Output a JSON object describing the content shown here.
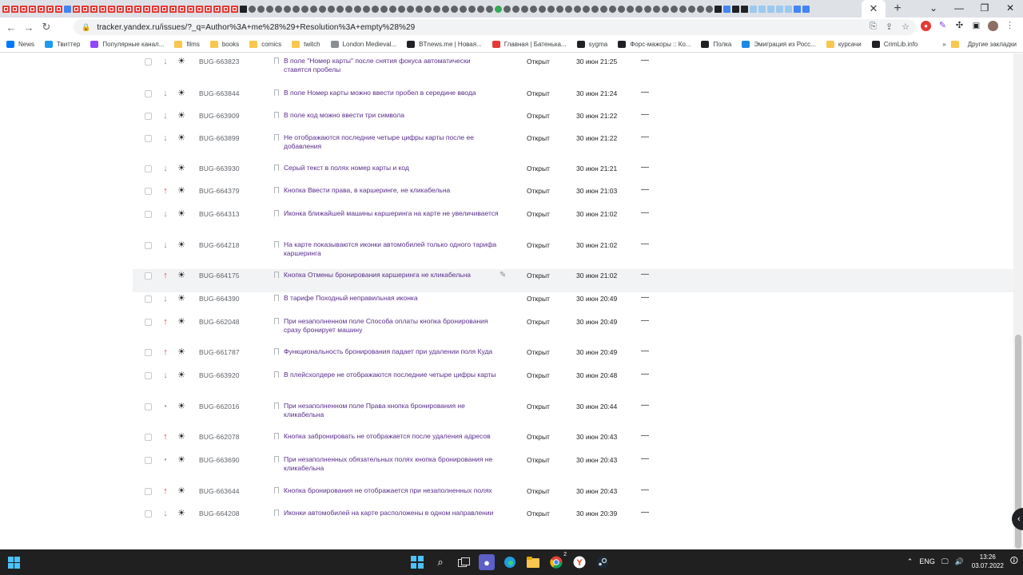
{
  "browser": {
    "tab_icon_kinds": [
      "red",
      "red",
      "red",
      "red",
      "red",
      "red",
      "red",
      "blue",
      "red",
      "red",
      "red",
      "red",
      "red",
      "red",
      "red",
      "red",
      "red",
      "red",
      "red",
      "red",
      "red",
      "red",
      "red",
      "red",
      "red",
      "red",
      "red",
      "dark",
      "gray",
      "gray",
      "gray",
      "gray",
      "gray",
      "gray",
      "gray",
      "gray",
      "gray",
      "gray",
      "gray",
      "gray",
      "gray",
      "gray",
      "gray",
      "gray",
      "gray",
      "gray",
      "gray",
      "gray",
      "gray",
      "gray",
      "gray",
      "gray",
      "gray",
      "gray",
      "gray",
      "gray",
      "green",
      "gray",
      "gray",
      "gray",
      "gray",
      "gray",
      "gray",
      "gray",
      "gray",
      "gray",
      "gray",
      "gray",
      "gray",
      "gray",
      "gray",
      "gray",
      "gray",
      "gray",
      "gray",
      "gray",
      "gray",
      "gray",
      "gray",
      "gray",
      "gray",
      "dark",
      "blue",
      "dark",
      "dark",
      "light",
      "light",
      "light",
      "light",
      "light",
      "blue",
      "blue"
    ],
    "active_tab_close": "✕",
    "new_tab": "+",
    "window_controls": [
      "⌄",
      "—",
      "❐",
      "✕"
    ],
    "nav": {
      "back": "←",
      "forward": "→",
      "reload": "↻"
    },
    "url": "tracker.yandex.ru/issues/?_q=Author%3A+me%28%29+Resolution%3A+empty%28%29",
    "omnibox_icons": [
      "⎘",
      "⇪",
      "☆"
    ]
  },
  "bookmarks": [
    {
      "label": "News",
      "icon": "vk-icon",
      "color": "#0077ff"
    },
    {
      "label": "Твиттер",
      "icon": "twitter-icon",
      "color": "#1d9bf0"
    },
    {
      "label": "Популярные канал...",
      "icon": "twitch-icon",
      "color": "#9146ff"
    },
    {
      "label": "films",
      "icon": "folder-icon",
      "color": "#f9c74f"
    },
    {
      "label": "books",
      "icon": "folder-icon",
      "color": "#f9c74f"
    },
    {
      "label": "comics",
      "icon": "folder-icon",
      "color": "#f9c74f"
    },
    {
      "label": "twitch",
      "icon": "folder-icon",
      "color": "#f9c74f"
    },
    {
      "label": "London Medieval...",
      "icon": "page-icon",
      "color": "#8a8d91"
    },
    {
      "label": "BTnews.me | Новая...",
      "icon": "bt-icon",
      "color": "#202124"
    },
    {
      "label": "Главная | Батенька...",
      "icon": "batenka-icon",
      "color": "#e53935"
    },
    {
      "label": "sygma",
      "icon": "sygma-icon",
      "color": "#202124"
    },
    {
      "label": "Форс-мажоры :: Ко...",
      "icon": "force-icon",
      "color": "#202124"
    },
    {
      "label": "Полка",
      "icon": "polka-icon",
      "color": "#202124"
    },
    {
      "label": "Эмиграция из Росс...",
      "icon": "plane-icon",
      "color": "#1e88e5"
    },
    {
      "label": "курсачи",
      "icon": "folder-icon",
      "color": "#f9c74f"
    },
    {
      "label": "CrimLib.info",
      "icon": "crimlib-icon",
      "color": "#202124"
    }
  ],
  "bookmarks_more": "»",
  "bookmarks_other": "Другие закладки",
  "issues": [
    {
      "key": "BUG-663823",
      "priority": "down",
      "title": "В поле \"Номер карты\" после снятия фокуса автоматически ставятся пробелы",
      "status": "Открыт",
      "date": "30 июн 21:25",
      "resolution": "—"
    },
    {
      "key": "BUG-663844",
      "priority": "down",
      "title": "В поле Номер карты можно ввести пробел в середине ввода",
      "status": "Открыт",
      "date": "30 июн 21:24",
      "resolution": "—"
    },
    {
      "key": "BUG-663909",
      "priority": "down",
      "title": "В поле код можно ввести три символа",
      "status": "Открыт",
      "date": "30 июн 21:22",
      "resolution": "—"
    },
    {
      "key": "BUG-663899",
      "priority": "down",
      "title": "Не отображаются последние четыре цифры карты после ее добавления",
      "status": "Открыт",
      "date": "30 июн 21:22",
      "resolution": "—"
    },
    {
      "key": "BUG-663930",
      "priority": "down",
      "title": "Серый текст в полях номер карты и код",
      "status": "Открыт",
      "date": "30 июн 21:21",
      "resolution": "—"
    },
    {
      "key": "BUG-664379",
      "priority": "up",
      "title": "Кнопка Ввести права, в каршеринге, не кликабельна",
      "status": "Открыт",
      "date": "30 июн 21:03",
      "resolution": "—"
    },
    {
      "key": "BUG-664313",
      "priority": "down",
      "title": "Иконка ближайшей машины каршеринга на карте не увеличивается",
      "status": "Открыт",
      "date": "30 июн 21:02",
      "resolution": "—"
    },
    {
      "key": "BUG-664218",
      "priority": "down",
      "title": "На карте показываются иконки автомобилей только одного тарифа каршеринга",
      "status": "Открыт",
      "date": "30 июн 21:02",
      "resolution": "—"
    },
    {
      "key": "BUG-664175",
      "priority": "up",
      "title": "Кнопка Отмены бронирования каршеринга не кликабельна",
      "status": "Открыт",
      "date": "30 июн 21:02",
      "resolution": "—"
    },
    {
      "key": "BUG-664390",
      "priority": "down",
      "title": "В тарифе Походный неправильная иконка",
      "status": "Открыт",
      "date": "30 июн 20:49",
      "resolution": "—"
    },
    {
      "key": "BUG-662048",
      "priority": "up",
      "title": "При незаполненном поле Способа оплаты кнопка бронирования сразу бронирует машину",
      "status": "Открыт",
      "date": "30 июн 20:49",
      "resolution": "—"
    },
    {
      "key": "BUG-661787",
      "priority": "up",
      "title": "Функциональность бронирования падает при удалении поля Куда",
      "status": "Открыт",
      "date": "30 июн 20:49",
      "resolution": "—"
    },
    {
      "key": "BUG-663920",
      "priority": "down",
      "title": "В плейсхолдере не отображаются последние четыре цифры карты",
      "status": "Открыт",
      "date": "30 июн 20:48",
      "resolution": "—"
    },
    {
      "key": "BUG-662016",
      "priority": "normal",
      "title": "При незаполненном поле Права кнопка бронирования не кликабельна",
      "status": "Открыт",
      "date": "30 июн 20:44",
      "resolution": "—"
    },
    {
      "key": "BUG-662078",
      "priority": "up",
      "title": "Кнопка забронировать не отображается после удаления адресов",
      "status": "Открыт",
      "date": "30 июн 20:43",
      "resolution": "—"
    },
    {
      "key": "BUG-663690",
      "priority": "normal",
      "title": "При незаполненных обязательных полях кнопка бронирования не кликабельна",
      "status": "Открыт",
      "date": "30 июн 20:43",
      "resolution": "—"
    },
    {
      "key": "BUG-663644",
      "priority": "up",
      "title": "Кнопка бронирования не отображается при незаполненных полях",
      "status": "Открыт",
      "date": "30 июн 20:43",
      "resolution": "—"
    },
    {
      "key": "BUG-664208",
      "priority": "down",
      "title": "Иконки автомобилей на карте расположены в одном направлении",
      "status": "Открыт",
      "date": "30 июн 20:39",
      "resolution": "—"
    }
  ],
  "hovered_issue": "BUG-664175",
  "taskbar": {
    "lang": "ENG",
    "time": "13:26",
    "date": "03.07.2022",
    "chrome_badge": "2"
  }
}
